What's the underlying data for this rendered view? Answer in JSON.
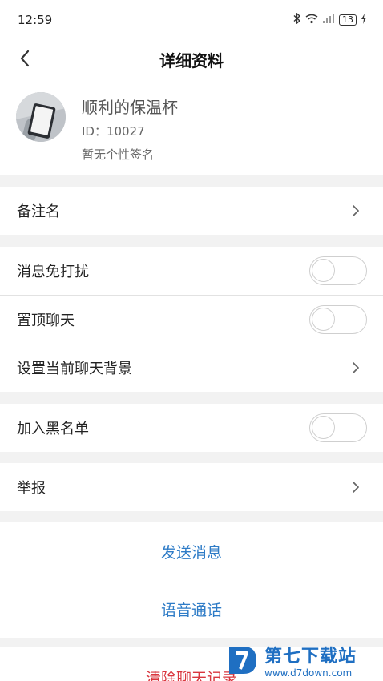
{
  "status": {
    "time": "12:59",
    "battery": "13"
  },
  "nav": {
    "title": "详细资料"
  },
  "profile": {
    "name": "顺利的保温杯",
    "id_text": "ID：10027",
    "signature": "暂无个性签名"
  },
  "rows": {
    "remark": "备注名",
    "mute": "消息免打扰",
    "pin": "置顶聊天",
    "background": "设置当前聊天背景",
    "blacklist": "加入黑名单",
    "report": "举报"
  },
  "toggles": {
    "mute": false,
    "pin": false,
    "blacklist": false
  },
  "actions": {
    "send": "发送消息",
    "voice": "语音通话",
    "clear": "清除聊天记录"
  },
  "watermark": {
    "title": "第七下载站",
    "url": "www.d7down.com"
  },
  "colors": {
    "link": "#2f7cc7",
    "danger": "#d9363e",
    "background": "#f2f2f2"
  }
}
